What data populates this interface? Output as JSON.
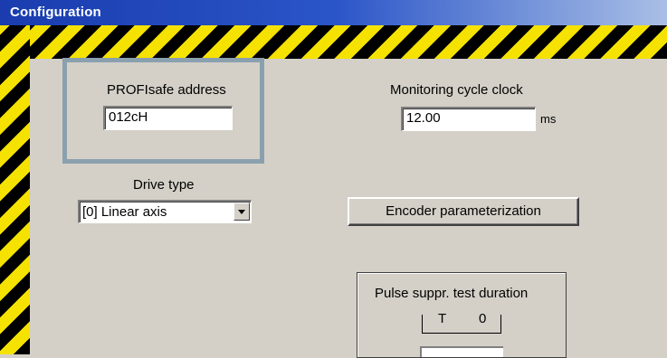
{
  "window": {
    "title": "Configuration"
  },
  "profisafe": {
    "label": "PROFIsafe address",
    "value": "012cH"
  },
  "monitoring": {
    "label": "Monitoring cycle clock",
    "value": "12.00",
    "unit": "ms"
  },
  "drive": {
    "label": "Drive type",
    "selected": "[0] Linear axis"
  },
  "encoder": {
    "button_label": "Encoder parameterization"
  },
  "pulse": {
    "label": "Pulse suppr. test duration",
    "timer_left": "T",
    "timer_right": "0"
  },
  "colors": {
    "hazard_yellow": "#f5e200",
    "hazard_black": "#000000",
    "titlebar": "#1a3cae",
    "panel": "#d4d0c8",
    "highlight": "#8aa0ae"
  }
}
